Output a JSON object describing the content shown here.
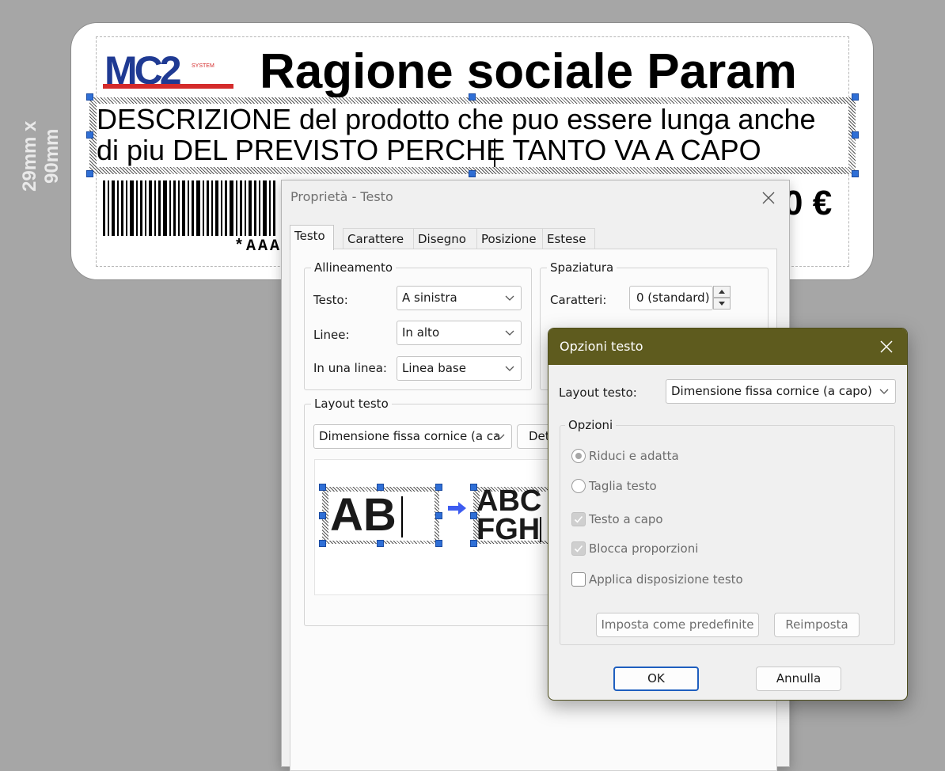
{
  "canvas": {
    "size_label": "29mm x 90mm",
    "logo_text": "MC2",
    "logo_subtext": "SYSTEM",
    "company_name": "Ragione sociale Param",
    "description": "DESCRIZIONE del prodotto che puo essere lunga anche\ndi piu DEL PREVISTO PERCHE TANTO VA A CAPO",
    "barcode_text": "*AAA",
    "price": "0 €"
  },
  "properties": {
    "title": "Proprietà - Testo",
    "tabs": [
      "Testo",
      "Carattere",
      "Disegno",
      "Posizione",
      "Estese"
    ],
    "alignment": {
      "group_title": "Allineamento",
      "text_label": "Testo:",
      "text_value": "A sinistra",
      "lines_label": "Linee:",
      "lines_value": "In alto",
      "single_line_label": "In una linea:",
      "single_line_value": "Linea base"
    },
    "spacing": {
      "group_title": "Spaziatura",
      "chars_label": "Caratteri:",
      "chars_value": "0 (standard)"
    },
    "layout": {
      "group_title": "Layout testo",
      "value": "Dimensione fissa cornice (a ca",
      "details_button": "Det",
      "preview_before": "AB",
      "preview_after_line1": "ABC",
      "preview_after_line2": "FGH"
    }
  },
  "options": {
    "title": "Opzioni testo",
    "layout_label": "Layout testo:",
    "layout_value": "Dimensione fissa cornice (a capo)",
    "group_title": "Opzioni",
    "radio_shrink": "Riduci e adatta",
    "radio_cut": "Taglia testo",
    "check_wrap": "Testo a capo",
    "check_lock": "Blocca proporzioni",
    "check_apply": "Applica disposizione testo",
    "set_default_button": "Imposta come predefinite",
    "reset_button": "Reimposta",
    "ok_button": "OK",
    "cancel_button": "Annulla"
  },
  "colors": {
    "accent_titlebar": "#5e5b1e",
    "selection_handle": "#2f6fd6",
    "logo_blue": "#1f3a93",
    "logo_red": "#d42b2b",
    "preview_arrow": "#3d5cf0"
  }
}
